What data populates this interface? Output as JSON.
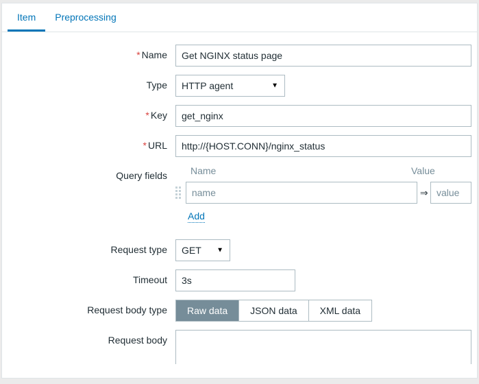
{
  "tabs": {
    "item": "Item",
    "preprocessing": "Preprocessing"
  },
  "labels": {
    "name": "Name",
    "type": "Type",
    "key": "Key",
    "url": "URL",
    "query_fields": "Query fields",
    "request_type": "Request type",
    "timeout": "Timeout",
    "request_body_type": "Request body type",
    "request_body": "Request body"
  },
  "values": {
    "name": "Get NGINX status page",
    "type": "HTTP agent",
    "key": "get_nginx",
    "url": "http://{HOST.CONN}/nginx_status",
    "request_type": "GET",
    "timeout": "3s"
  },
  "query_fields": {
    "header_name": "Name",
    "header_value": "Value",
    "name_placeholder": "name",
    "value_placeholder": "value",
    "add": "Add",
    "arrow": "⇒"
  },
  "body_type": {
    "raw": "Raw data",
    "json": "JSON data",
    "xml": "XML data"
  }
}
